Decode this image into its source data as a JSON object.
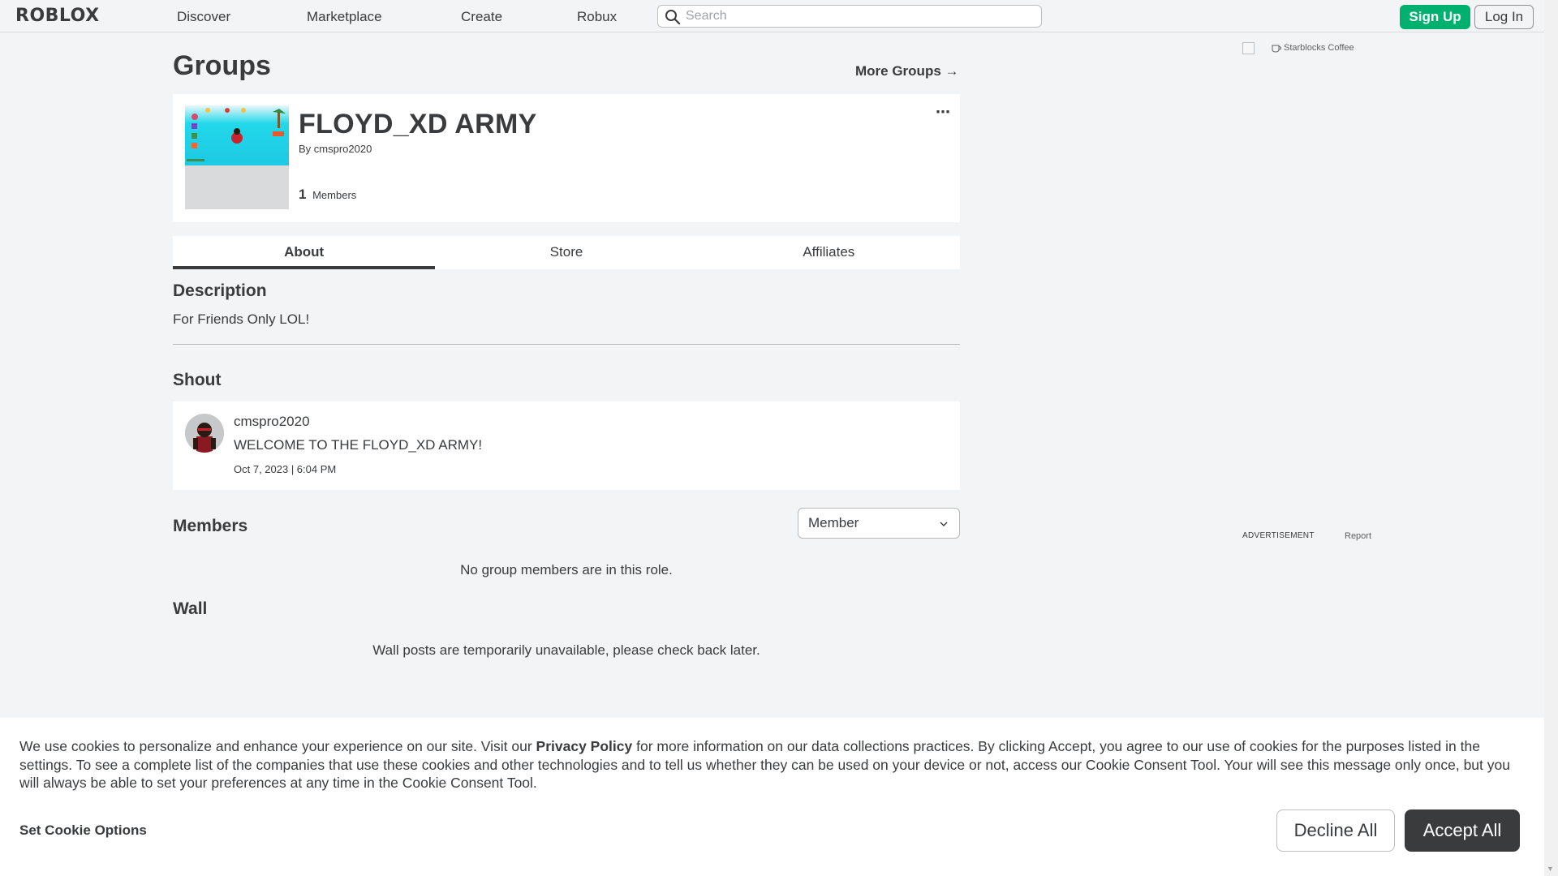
{
  "nav": {
    "logo": "ROBLOX",
    "links": [
      "Discover",
      "Marketplace",
      "Create",
      "Robux"
    ],
    "search_placeholder": "Search",
    "signup_label": "Sign Up",
    "login_label": "Log In"
  },
  "page": {
    "title": "Groups",
    "more_groups": "More Groups →"
  },
  "group": {
    "name": "FLOYD_XD ARMY",
    "by_prefix": "By",
    "owner": "cmspro2020",
    "member_count": "1",
    "member_label": "Members",
    "more_icon": "⋯"
  },
  "tabs": [
    {
      "label": "About",
      "active": true
    },
    {
      "label": "Store",
      "active": false
    },
    {
      "label": "Affiliates",
      "active": false
    }
  ],
  "description": {
    "heading": "Description",
    "text": "For Friends Only LOL!"
  },
  "shout": {
    "heading": "Shout",
    "user": "cmspro2020",
    "body": "WELCOME TO THE FLOYD_XD ARMY!",
    "date": "Oct 7, 2023 | 6:04 PM"
  },
  "members": {
    "heading": "Members",
    "role_selected": "Member",
    "empty_message": "No group members are in this role."
  },
  "wall": {
    "heading": "Wall",
    "message": "Wall posts are temporarily unavailable, please check back later."
  },
  "ad": {
    "brand": "Starblocks Coffee",
    "label": "ADVERTISEMENT",
    "report": "Report"
  },
  "cookie": {
    "text_1": "We use cookies to personalize and enhance your experience on our site. Visit our ",
    "privacy_link": "Privacy Policy",
    "text_2": " for more information on our data collections practices. By clicking Accept, you agree to our use of cookies for the purposes listed in the settings. To see a complete list of the companies that use these cookies and other technologies and to tell us whether they can be used on your device or not, access our Cookie Consent Tool. Your will see this message only once, but you will always be able to set your preferences at any time in the Cookie Consent Tool.",
    "options_label": "Set Cookie Options",
    "decline_label": "Decline All",
    "accept_label": "Accept All"
  },
  "colors": {
    "signup_green": "#00b06f",
    "accept_dark": "#393b3d",
    "page_bg": "#f2f4f5"
  }
}
